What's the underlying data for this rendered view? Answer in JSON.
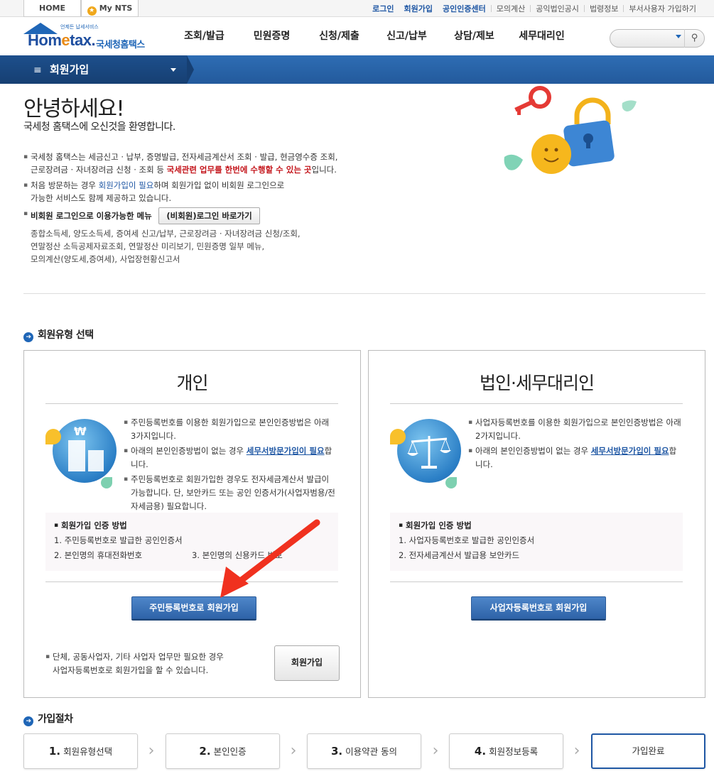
{
  "topbar": {
    "home": "HOME",
    "mynts": "My NTS",
    "links": [
      "로그인",
      "회원가입",
      "공인인증센터",
      "모의계산",
      "공익법인공시",
      "법령정보",
      "부서사용자 가입하기"
    ]
  },
  "header": {
    "logo_small": "언제든 납세서비스",
    "logo_kor": "국세청홈택스",
    "gnb": [
      "조회/발급",
      "민원증명",
      "신청/제출",
      "신고/납부",
      "상담/제보",
      "세무대리인"
    ]
  },
  "navbar": {
    "title": "회원가입"
  },
  "welcome": {
    "heading": "안녕하세요!",
    "sub": "국세청 홈택스에 오신것을 환영합니다.",
    "b1_a": "국세청 홈택스는 세금신고 · 납부, 증명발급, 전자세금계산서 조회 · 발급, 현금영수증 조회,",
    "b1_b": "근로장려금 · 자녀장려금 신청 · 조회 등 ",
    "b1_red": "국세관련 업무를 한번에 수행할 수 있는 곳",
    "b1_c": "입니다.",
    "b2_a": "처음 방문하는 경우 ",
    "b2_blue": "회원가입이 필요",
    "b2_b": "하며 회원가입 없이 비회원 로그인으로",
    "b2_c": "가능한 서비스도 함께 제공하고 있습니다.",
    "b3": "비회원 로그인으로 이용가능한 메뉴",
    "guest_btn": "(비회원)로그인 바로가기",
    "menu1": "종합소득세, 양도소득세, 증여세 신고/납부, 근로장려금 · 자녀장려금 신청/조회,",
    "menu2": "연말정산 소득공제자료조회, 연말정산 미리보기, 민원증명 일부 메뉴,",
    "menu3": "모의계산(양도세,증여세), 사업장현황신고서"
  },
  "member_type": {
    "title": "회원유형 선택",
    "personal": {
      "title": "개인",
      "d1": "주민등록번호를 이용한 회원가입으로 본인인증방법은 아래 3가지입니다.",
      "d2_a": "아래의 본인인증방법이 없는 경우 ",
      "d2_link": "세무서방문가입이 필요",
      "d2_b": "합니다.",
      "d3": "주민등록번호로 회원가입한 경우도 전자세금계산서 발급이 가능합니다. 단, 보안카드 또는 공인 인증서가(사업자범용/전자세금용) 필요합니다.",
      "auth_title": "회원가입 인증 방법",
      "auth1": "1. 주민등록번호로 발급한 공인인증서",
      "auth2": "2. 본인명의 휴대전화번호",
      "auth3": "3. 본인명의 신용카드 번호",
      "button": "주민등록번호로 회원가입",
      "foot1": "단체, 공동사업자, 기타 사업자 업무만 필요한 경우",
      "foot2": "사업자등록번호로 회원가입을 할 수 있습니다.",
      "join_btn": "회원가입"
    },
    "corporate": {
      "title": "법인·세무대리인",
      "d1": "사업자등록번호를 이용한 회원가입으로 본인인증방법은 아래 2가지입니다.",
      "d2_a": "아래의 본인인증방법이 없는 경우 ",
      "d2_link": "세무서방문가입이 필요",
      "d2_b": "합니다.",
      "auth_title": "회원가입 인증 방법",
      "auth1": "1. 사업자등록번호로 발급한 공인인증서",
      "auth2": "2. 전자세금계산서 발급용 보안카드",
      "button": "사업자등록번호로 회원가입"
    }
  },
  "procedure": {
    "title": "가입절차",
    "steps": [
      {
        "num": "1.",
        "label": "회원유형선택"
      },
      {
        "num": "2.",
        "label": "본인인증"
      },
      {
        "num": "3.",
        "label": "이용약관 동의"
      },
      {
        "num": "4.",
        "label": "회원정보등록"
      },
      {
        "num": "",
        "label": "가입완료"
      }
    ]
  }
}
